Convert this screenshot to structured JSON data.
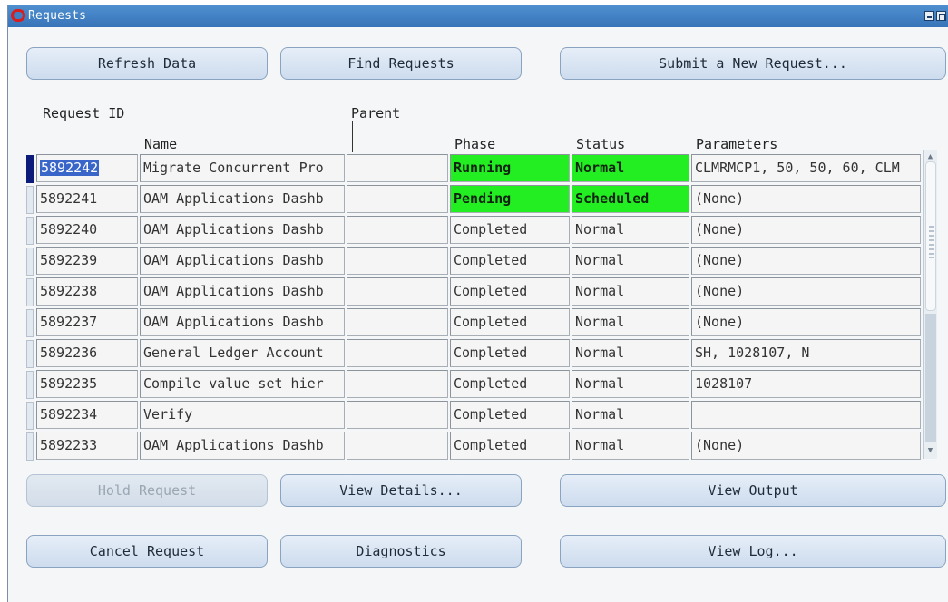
{
  "window": {
    "title": "Requests"
  },
  "toolbar": {
    "refresh_label": "Refresh Data",
    "find_label": "Find Requests",
    "submit_label": "Submit a New Request..."
  },
  "columns": {
    "request_id": "Request ID",
    "parent": "Parent",
    "name": "Name",
    "phase": "Phase",
    "status": "Status",
    "parameters": "Parameters"
  },
  "rows": [
    {
      "id": "5892242",
      "name": "Migrate Concurrent Pro",
      "parent": "",
      "phase": "Running",
      "status": "Normal",
      "parameters": "CLMRMCP1, 50, 50, 60, CLM"
    },
    {
      "id": "5892241",
      "name": "OAM Applications Dashb",
      "parent": "",
      "phase": "Pending",
      "status": "Scheduled",
      "parameters": "(None)"
    },
    {
      "id": "5892240",
      "name": "OAM Applications Dashb",
      "parent": "",
      "phase": "Completed",
      "status": "Normal",
      "parameters": "(None)"
    },
    {
      "id": "5892239",
      "name": "OAM Applications Dashb",
      "parent": "",
      "phase": "Completed",
      "status": "Normal",
      "parameters": "(None)"
    },
    {
      "id": "5892238",
      "name": "OAM Applications Dashb",
      "parent": "",
      "phase": "Completed",
      "status": "Normal",
      "parameters": "(None)"
    },
    {
      "id": "5892237",
      "name": "OAM Applications Dashb",
      "parent": "",
      "phase": "Completed",
      "status": "Normal",
      "parameters": "(None)"
    },
    {
      "id": "5892236",
      "name": "General Ledger Account",
      "parent": "",
      "phase": "Completed",
      "status": "Normal",
      "parameters": "SH, 1028107, N"
    },
    {
      "id": "5892235",
      "name": "Compile value set hier",
      "parent": "",
      "phase": "Completed",
      "status": "Normal",
      "parameters": "1028107"
    },
    {
      "id": "5892234",
      "name": "Verify",
      "parent": "",
      "phase": "Completed",
      "status": "Normal",
      "parameters": ""
    },
    {
      "id": "5892233",
      "name": "OAM Applications Dashb",
      "parent": "",
      "phase": "Completed",
      "status": "Normal",
      "parameters": "(None)"
    }
  ],
  "actions": {
    "hold_label": "Hold Request",
    "view_details_label": "View Details...",
    "view_output_label": "View Output",
    "cancel_label": "Cancel Request",
    "diagnostics_label": "Diagnostics",
    "view_log_label": "View Log..."
  },
  "colors": {
    "title_bar": "#3f7fc4",
    "active_green": "#22ee22",
    "button_face": "#dbe6f3",
    "selection": "#3a66c9"
  },
  "icons": [
    "oracle-logo-icon",
    "minimize-icon",
    "maximize-icon",
    "scroll-up-icon",
    "scroll-down-icon"
  ]
}
